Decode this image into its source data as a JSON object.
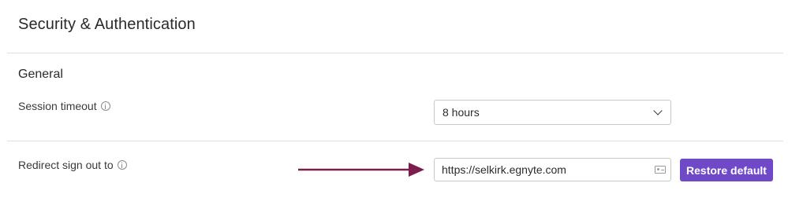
{
  "header": {
    "title": "Security & Authentication"
  },
  "section": {
    "title": "General"
  },
  "settings": {
    "session_timeout": {
      "label": "Session timeout",
      "info_icon": "info-circle-icon",
      "selected_value": "8 hours",
      "dropdown_icon": "chevron-down-icon"
    },
    "redirect_sign_out": {
      "label": "Redirect sign out to",
      "info_icon": "info-circle-icon",
      "value": "https://selkirk.egnyte.com",
      "field_icon": "contact-card-icon",
      "restore_button_label": "Restore default"
    }
  },
  "annotation": {
    "arrow_icon": "arrow-right-icon",
    "arrow_color": "#7a1f4d"
  },
  "colors": {
    "accent": "#6f49c8",
    "divider": "#dedede"
  }
}
